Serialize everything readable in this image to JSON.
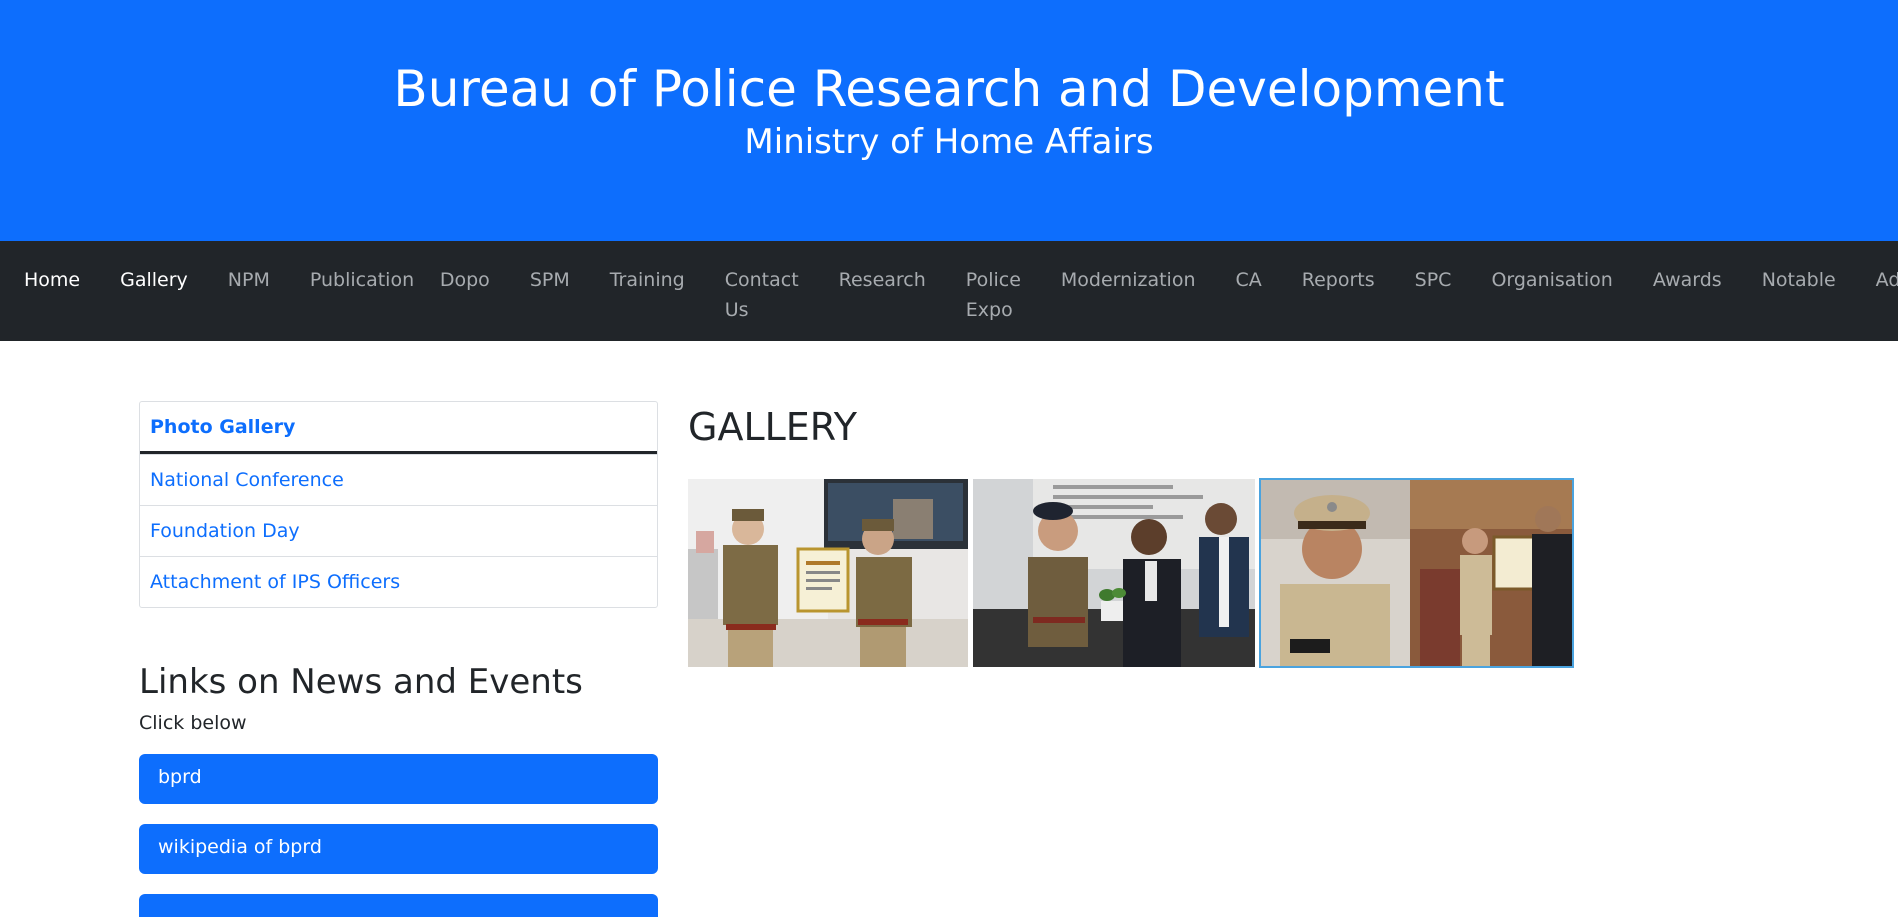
{
  "header": {
    "title": "Bureau of Police Research and Development",
    "subtitle": "Ministry of Home Affairs"
  },
  "nav": {
    "items": [
      {
        "label": "Home"
      },
      {
        "label": "Gallery"
      },
      {
        "label": "NPM"
      },
      {
        "label": "Publication"
      },
      {
        "label": "Dopo"
      },
      {
        "label": "SPM"
      },
      {
        "label": "Training"
      },
      {
        "label": "Contact Us"
      },
      {
        "label": "Research"
      },
      {
        "label": "Police Expo"
      },
      {
        "label": "Modernization"
      },
      {
        "label": "CA"
      },
      {
        "label": "Reports"
      },
      {
        "label": "SPC"
      },
      {
        "label": "Organisation"
      },
      {
        "label": "Awards"
      },
      {
        "label": "Notable"
      },
      {
        "label": "Admin"
      }
    ]
  },
  "sidebar": {
    "header": "Photo Gallery",
    "items": [
      {
        "label": "National Conference"
      },
      {
        "label": "Foundation Day"
      },
      {
        "label": "Attachment of IPS Officers"
      }
    ]
  },
  "links": {
    "title": "Links on News and Events",
    "subtitle": "Click below",
    "buttons": [
      {
        "label": "bprd"
      },
      {
        "label": "wikipedia of bprd"
      },
      {
        "label": ""
      }
    ]
  },
  "gallery": {
    "title": "GALLERY"
  },
  "colors": {
    "header_bg": "#0d6efd",
    "nav_bg": "#212529",
    "link": "#0d6efd",
    "button_bg": "#0d6efd"
  }
}
